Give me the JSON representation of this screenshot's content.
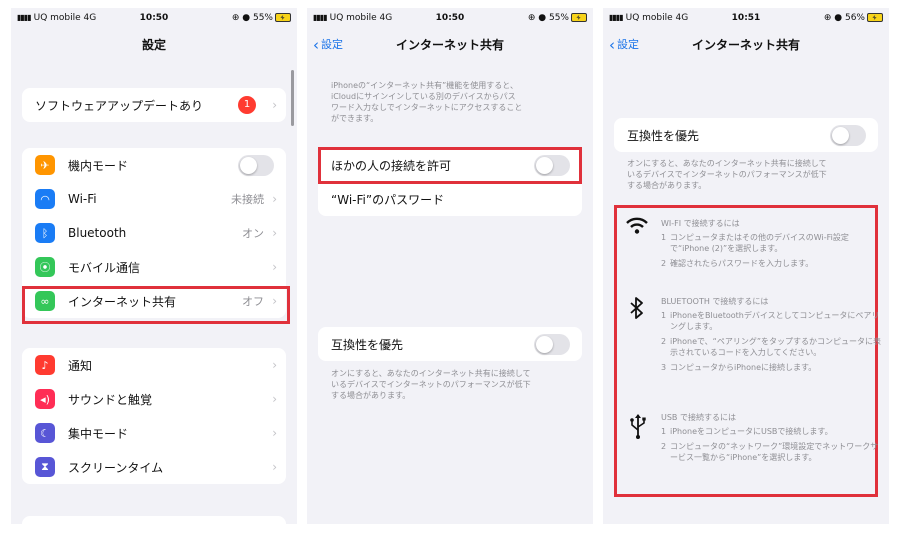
{
  "status_bars": [
    {
      "carrier": "UQ mobile",
      "net": "4G",
      "time": "10:50",
      "battery": "55%"
    },
    {
      "carrier": "UQ mobile",
      "net": "4G",
      "time": "10:50",
      "battery": "55%"
    },
    {
      "carrier": "UQ mobile",
      "net": "4G",
      "time": "10:51",
      "battery": "56%"
    }
  ],
  "settings": {
    "title": "設定",
    "software_update": {
      "label": "ソフトウェアアップデートあり",
      "badge": "1"
    },
    "group1": [
      {
        "label": "機内モード",
        "icon": "airplane-icon",
        "color": "#ff9500"
      },
      {
        "label": "Wi-Fi",
        "value": "未接続",
        "icon": "wifi-icon",
        "color": "#1a7cf5"
      },
      {
        "label": "Bluetooth",
        "value": "オン",
        "icon": "bluetooth-icon",
        "color": "#1a7cf5"
      },
      {
        "label": "モバイル通信",
        "icon": "antenna-icon",
        "color": "#34c759"
      },
      {
        "label": "インターネット共有",
        "value": "オフ",
        "icon": "link-icon",
        "color": "#34c759"
      }
    ],
    "group2": [
      {
        "label": "通知",
        "icon": "bell-icon",
        "color": "#ff3b30"
      },
      {
        "label": "サウンドと触覚",
        "icon": "speaker-icon",
        "color": "#ff2d55"
      },
      {
        "label": "集中モード",
        "icon": "moon-icon",
        "color": "#5856d6"
      },
      {
        "label": "スクリーンタイム",
        "icon": "hourglass-icon",
        "color": "#5856d6"
      }
    ]
  },
  "hotspot": {
    "back": "設定",
    "title": "インターネット共有",
    "intro": [
      "iPhoneの“インターネット共有”機能を使用すると、",
      "iCloudにサインインしている別のデバイスからパス",
      "ワード入力なしでインターネットにアクセスすること",
      "ができます。"
    ],
    "allow_others": "ほかの人の接続を許可",
    "wifi_password": "“Wi-Fi”のパスワード",
    "compat": "互換性を優先",
    "compat_note": [
      "オンにすると、あなたのインターネット共有に接続して",
      "いるデバイスでインターネットのパフォーマンスが低下",
      "する場合があります。"
    ]
  },
  "hotspot2": {
    "back": "設定",
    "title": "インターネット共有",
    "compat": "互換性を優先",
    "compat_note": [
      "オンにすると、あなたのインターネット共有に接続して",
      "いるデバイスでインターネットのパフォーマンスが低下",
      "する場合があります。"
    ],
    "wifi": {
      "heading": "WI-FI で接続するには",
      "steps": [
        {
          "n": "1",
          "text": "コンピュータまたはその他のデバイスのWi-Fi設定で“iPhone (2)”を選択します。"
        },
        {
          "n": "2",
          "text": "確認されたらパスワードを入力します。"
        }
      ]
    },
    "bluetooth": {
      "heading": "BLUETOOTH で接続するには",
      "steps": [
        {
          "n": "1",
          "text": "iPhoneをBluetoothデバイスとしてコンピュータにペアリングします。"
        },
        {
          "n": "2",
          "text": "iPhoneで、“ペアリング”をタップするかコンピュータに表示されているコードを入力してください。"
        },
        {
          "n": "3",
          "text": "コンピュータからiPhoneに接続します。"
        }
      ]
    },
    "usb": {
      "heading": "USB で接続するには",
      "steps": [
        {
          "n": "1",
          "text": "iPhoneをコンピュータにUSBで接続します。"
        },
        {
          "n": "2",
          "text": "コンピュータの“ネットワーク”環境設定でネットワークサービス一覧から“iPhone”を選択します。"
        }
      ]
    }
  }
}
